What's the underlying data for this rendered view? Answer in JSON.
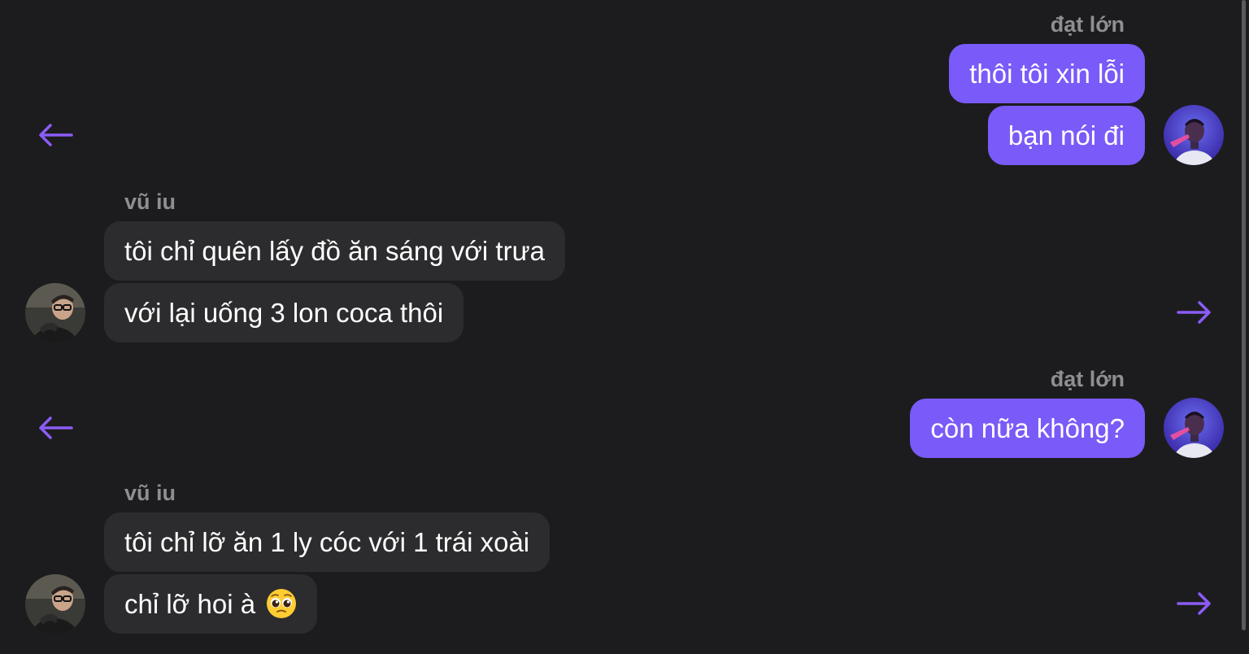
{
  "colors": {
    "background": "#1c1c1e",
    "outgoing_bubble": "#7a5af8",
    "incoming_bubble": "#2c2c2e",
    "sender_name": "#8e8e93",
    "arrow_accent": "#8b5cf6"
  },
  "messages": [
    {
      "sender": "đạt lớn",
      "direction": "outgoing",
      "lines": [
        "thôi tôi xin lỗi",
        "bạn nói đi"
      ],
      "action_icon": "arrow-left-icon"
    },
    {
      "sender": "vũ iu",
      "direction": "incoming",
      "lines": [
        "tôi chỉ quên lấy đồ ăn sáng với trưa",
        "với lại uống 3 lon coca thôi"
      ],
      "action_icon": "arrow-right-icon"
    },
    {
      "sender": "đạt lớn",
      "direction": "outgoing",
      "lines": [
        "còn nữa không?"
      ],
      "action_icon": "arrow-left-icon"
    },
    {
      "sender": "vũ iu",
      "direction": "incoming",
      "lines": [
        "tôi chỉ lỡ ăn 1 ly cóc với 1 trái xoài",
        "chỉ lỡ hoi à"
      ],
      "emoji": "pleading-face-emoji",
      "action_icon": "arrow-right-icon"
    }
  ]
}
